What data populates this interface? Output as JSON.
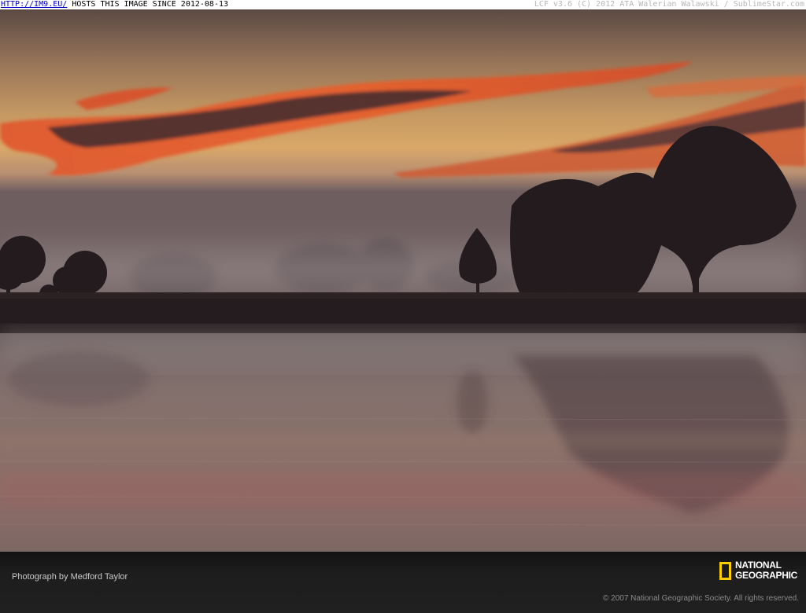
{
  "topbar": {
    "link": "HTTP://IM9.EU/",
    "hosts": "HOSTS THIS IMAGE SINCE 2012-08-13",
    "right": "LCF v3.6 (C) 2012 ATA Walerian Walawski / SublimeStar.com"
  },
  "footer": {
    "credit": "Photograph by Medford Taylor",
    "copyright": "© 2007 National Geographic Society. All rights reserved.",
    "logo_line1": "NATIONAL",
    "logo_line2": "GEOGRAPHIC"
  },
  "colors": {
    "logo_yellow": "#ffcc00",
    "sky_top": "#5b4a44",
    "sky_glow": "#d9a868",
    "cloud": "#e0552a",
    "water": "#8c716a"
  },
  "photo": {
    "icons": [
      "sunset-sky",
      "red-clouds",
      "tree-silhouettes",
      "fog",
      "lake-reflection"
    ]
  }
}
